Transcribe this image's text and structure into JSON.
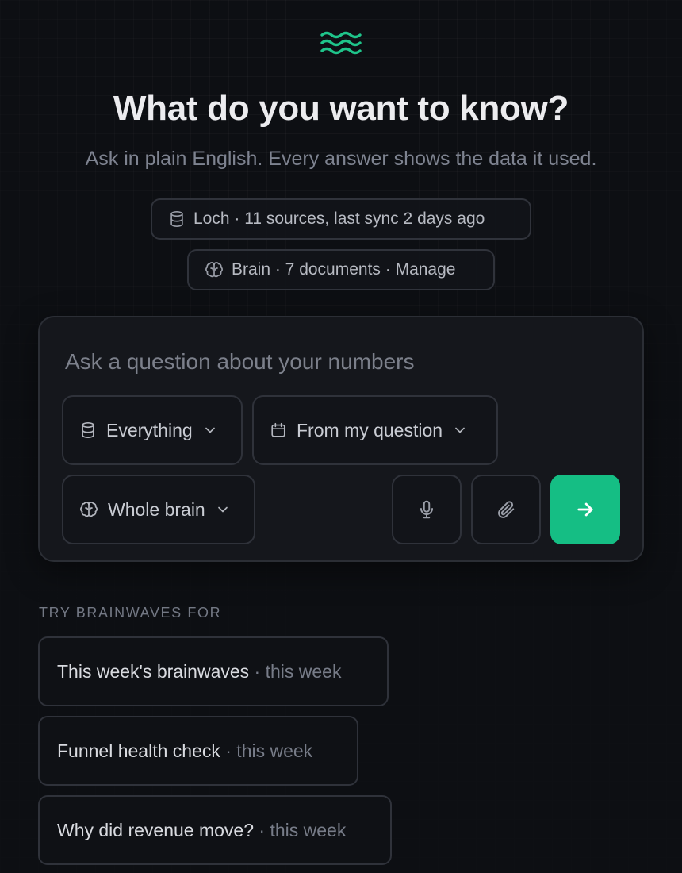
{
  "brand": {
    "logo_icon": "waves-icon",
    "accent_color": "#15be84"
  },
  "hero": {
    "title": "What do you want to know?",
    "subtitle": "Ask in plain English. Every answer shows the data it used."
  },
  "status_pills": {
    "loch": {
      "icon": "database-icon",
      "label": "Loch · 11 sources, last sync 2 days ago"
    },
    "brain": {
      "icon": "brain-icon",
      "label": "Brain · 7 documents · Manage"
    }
  },
  "composer": {
    "placeholder": "Ask a question about your numbers",
    "value": "",
    "scope_select": {
      "icon": "database-icon",
      "selected": "Everything"
    },
    "date_select": {
      "icon": "calendar-icon",
      "selected": "From my question"
    },
    "brain_select": {
      "icon": "brain-icon",
      "selected": "Whole brain"
    },
    "mic_button": {
      "icon": "microphone-icon"
    },
    "attach_button": {
      "icon": "paperclip-icon"
    },
    "send_button": {
      "icon": "arrow-right-icon"
    }
  },
  "suggestions": {
    "label": "TRY BRAINWAVES FOR",
    "items": [
      {
        "title": "This week's brainwaves",
        "meta": " · this week"
      },
      {
        "title": "Funnel health check",
        "meta": " · this week"
      },
      {
        "title": "Why did revenue move?",
        "meta": " · this week"
      }
    ]
  }
}
